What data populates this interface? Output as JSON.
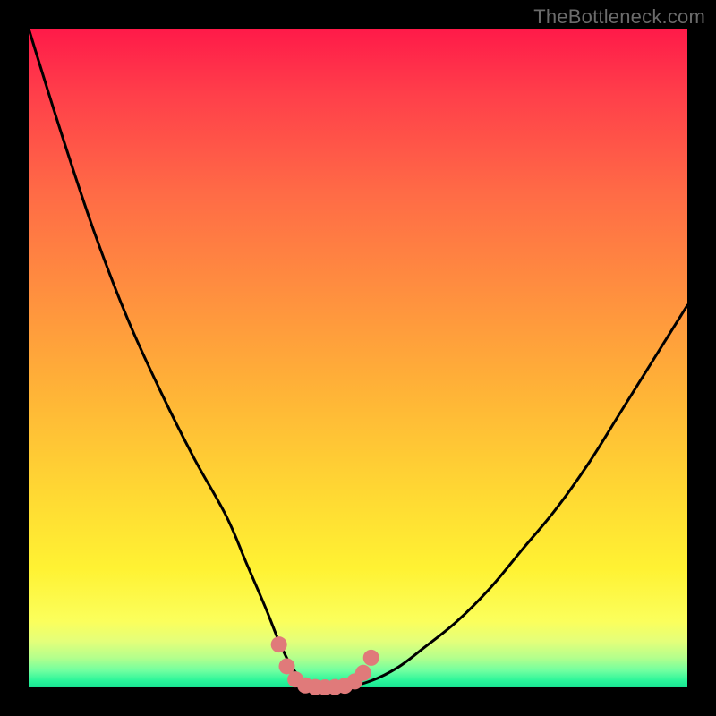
{
  "watermark": "TheBottleneck.com",
  "colors": {
    "background": "#000000",
    "gradient_top": "#ff1a49",
    "gradient_mid1": "#ff8f3f",
    "gradient_mid2": "#ffd733",
    "gradient_mid3": "#fff233",
    "gradient_bottom": "#18e493",
    "curve_stroke": "#000000",
    "marker_fill": "#e07a7a",
    "marker_stroke": "#d06868"
  },
  "chart_data": {
    "type": "line",
    "title": "",
    "xlabel": "",
    "ylabel": "",
    "xlim": [
      0,
      100
    ],
    "ylim": [
      0,
      100
    ],
    "series": [
      {
        "name": "bottleneck-curve",
        "x": [
          0,
          5,
          10,
          15,
          20,
          25,
          30,
          33,
          36,
          38,
          40,
          42,
          44,
          48,
          52,
          56,
          60,
          65,
          70,
          75,
          80,
          85,
          90,
          95,
          100
        ],
        "values": [
          100,
          84,
          69,
          56,
          45,
          35,
          26,
          19,
          12,
          7,
          3,
          1,
          0,
          0,
          1,
          3,
          6,
          10,
          15,
          21,
          27,
          34,
          42,
          50,
          58
        ]
      }
    ],
    "markers": {
      "name": "highlight-bottom",
      "x": [
        38,
        39.2,
        40.5,
        42,
        43.5,
        45,
        46.5,
        48,
        49.5,
        50.8,
        52
      ],
      "values": [
        6.5,
        3.2,
        1.2,
        0.3,
        0.05,
        0,
        0.05,
        0.25,
        0.9,
        2.2,
        4.5
      ]
    },
    "grid": false,
    "legend": false
  }
}
